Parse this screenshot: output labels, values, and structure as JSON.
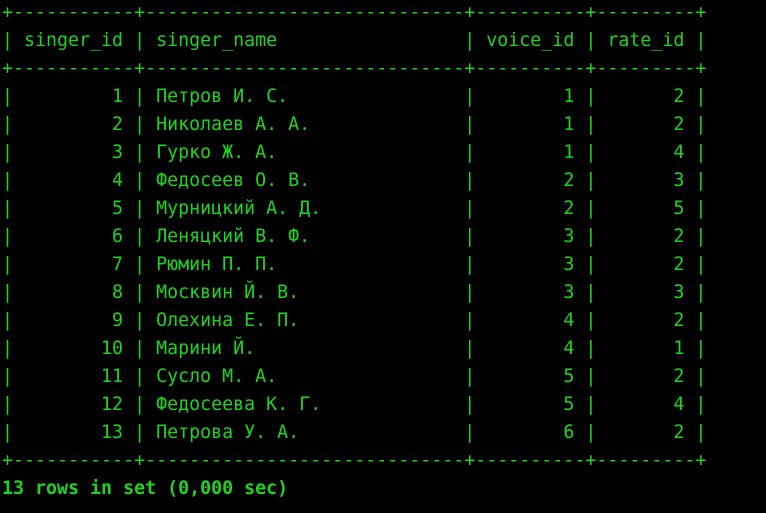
{
  "colors": {
    "background": "#000000",
    "text": "#1ed51e"
  },
  "table": {
    "border_line": "+-----------+-----------------------------+----------+---------+",
    "header_line": "| singer_id | singer_name                 | voice_id | rate_id |",
    "columns": [
      "singer_id",
      "singer_name",
      "voice_id",
      "rate_id"
    ],
    "rows": [
      {
        "singer_id": "1",
        "singer_name": "Петров И. С.",
        "voice_id": "1",
        "rate_id": "2",
        "line": "|         1 | Петров И. С.                |        1 |       2 |"
      },
      {
        "singer_id": "2",
        "singer_name": "Николаев А. А.",
        "voice_id": "1",
        "rate_id": "2",
        "line": "|         2 | Николаев А. А.              |        1 |       2 |"
      },
      {
        "singer_id": "3",
        "singer_name": "Гурко Ж. А.",
        "voice_id": "1",
        "rate_id": "4",
        "line": "|         3 | Гурко Ж. А.                 |        1 |       4 |"
      },
      {
        "singer_id": "4",
        "singer_name": "Федосеев О. В.",
        "voice_id": "2",
        "rate_id": "3",
        "line": "|         4 | Федосеев О. В.              |        2 |       3 |"
      },
      {
        "singer_id": "5",
        "singer_name": "Мурницкий А. Д.",
        "voice_id": "2",
        "rate_id": "5",
        "line": "|         5 | Мурницкий А. Д.             |        2 |       5 |"
      },
      {
        "singer_id": "6",
        "singer_name": "Леняцкий В. Ф.",
        "voice_id": "3",
        "rate_id": "2",
        "line": "|         6 | Леняцкий В. Ф.              |        3 |       2 |"
      },
      {
        "singer_id": "7",
        "singer_name": "Рюмин П. П.",
        "voice_id": "3",
        "rate_id": "2",
        "line": "|         7 | Рюмин П. П.                 |        3 |       2 |"
      },
      {
        "singer_id": "8",
        "singer_name": "Москвин Й. В.",
        "voice_id": "3",
        "rate_id": "3",
        "line": "|         8 | Москвин Й. В.               |        3 |       3 |"
      },
      {
        "singer_id": "9",
        "singer_name": "Олехина Е. П.",
        "voice_id": "4",
        "rate_id": "2",
        "line": "|         9 | Олехина Е. П.               |        4 |       2 |"
      },
      {
        "singer_id": "10",
        "singer_name": "Марини Й.",
        "voice_id": "4",
        "rate_id": "1",
        "line": "|        10 | Марини Й.                   |        4 |       1 |"
      },
      {
        "singer_id": "11",
        "singer_name": "Сусло М. А.",
        "voice_id": "5",
        "rate_id": "2",
        "line": "|        11 | Сусло М. А.                 |        5 |       2 |"
      },
      {
        "singer_id": "12",
        "singer_name": "Федосеева К. Г.",
        "voice_id": "5",
        "rate_id": "4",
        "line": "|        12 | Федосеева К. Г.             |        5 |       4 |"
      },
      {
        "singer_id": "13",
        "singer_name": "Петрова У. А.",
        "voice_id": "6",
        "rate_id": "2",
        "line": "|        13 | Петрова У. А.               |        6 |       2 |"
      }
    ]
  },
  "status": {
    "summary": "13 rows in set (0,000 sec)"
  }
}
